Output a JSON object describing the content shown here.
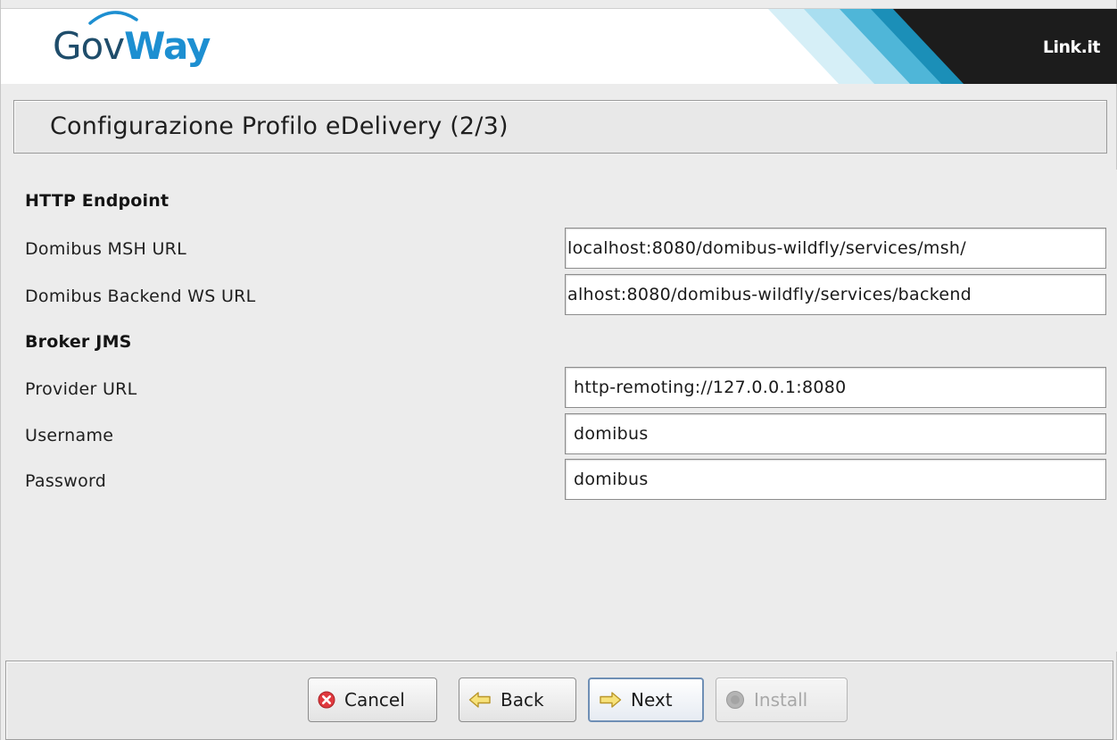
{
  "brand": {
    "logo_part1": "Gov",
    "logo_part2": "Way",
    "vendor": "Link.it",
    "colors": {
      "logo_dark": "#1f4d6b",
      "logo_accent": "#1d8fd1",
      "stripe_light": "#bfe6f2",
      "stripe_mid": "#4fb6d8",
      "stripe_dark": "#1b8fb8",
      "vendor_bg": "#1c1c1c"
    }
  },
  "page": {
    "title": "Configurazione Profilo eDelivery (2/3)"
  },
  "form": {
    "http_section": "HTTP Endpoint",
    "msh_label": "Domibus MSH URL",
    "msh_value": "/localhost:8080/domibus-wildfly/services/msh",
    "backend_label": "Domibus Backend WS URL",
    "backend_value": "alhost:8080/domibus-wildfly/services/backend",
    "jms_section": "Broker JMS",
    "provider_label": "Provider URL",
    "provider_value": "http-remoting://127.0.0.1:8080",
    "username_label": "Username",
    "username_value": "domibus",
    "password_label": "Password",
    "password_value": "domibus"
  },
  "buttons": {
    "cancel": "Cancel",
    "back": "Back",
    "next": "Next",
    "install": "Install",
    "icons": {
      "cancel": "cancel-x-icon",
      "back": "arrow-left-icon",
      "next": "arrow-right-icon",
      "install": "install-disc-icon"
    }
  }
}
